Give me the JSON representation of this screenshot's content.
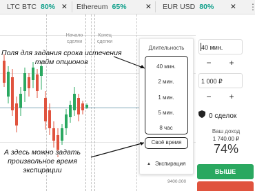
{
  "tabs": [
    {
      "name": "LTC BTC",
      "percent": "80%"
    },
    {
      "name": "Ethereum",
      "percent": "65%"
    },
    {
      "name": "EUR USD",
      "percent": "80%"
    }
  ],
  "tab_close_glyph": "✕",
  "kebab_glyph": "⋮",
  "chart": {
    "start_label": "Начало\nсделки",
    "end_label": "Конец\nсделки",
    "price_tick": "9400.000",
    "price_line_color": "#7fa6b6",
    "candle_colors": {
      "up": "#2aa860",
      "down": "#e0533e"
    }
  },
  "annotations": {
    "top": "Поля для задания срока истечения\nтайм опционов",
    "bottom": "А здесь можно задать\nпроизвольное время\nэкспирации"
  },
  "dropdown": {
    "title": "Длительность",
    "options": [
      "40 мин.",
      "2 мин.",
      "1 мин.",
      "5 мин.",
      "8 час"
    ],
    "custom_time": "Своё время",
    "expiration": "Экспирация",
    "expiration_icon": "caret-up-icon"
  },
  "panel": {
    "duration_value": "40 мин.",
    "amount_value": "1 000 ₽",
    "minus": "−",
    "plus": "+",
    "deals": "0 сделок",
    "income_label": "Ваш доход",
    "income_amount": "1 740.00 ₽",
    "income_percent": "74%",
    "buy_label": "ВЫШЕ"
  }
}
